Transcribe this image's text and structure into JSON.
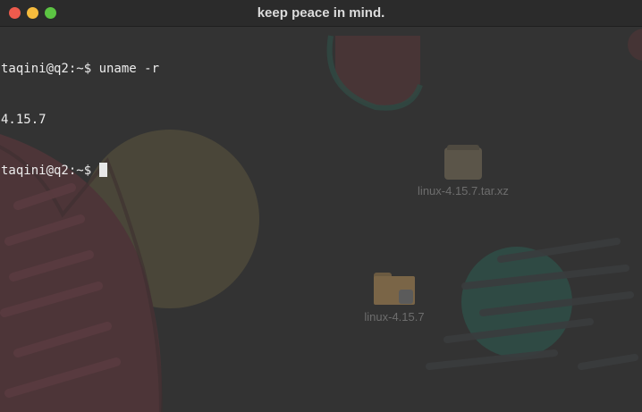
{
  "window": {
    "title": "keep peace in mind."
  },
  "terminal": {
    "lines": [
      "taqini@q2:~$ uname -r",
      "4.15.7",
      "taqini@q2:~$ "
    ]
  },
  "desktop": {
    "items": [
      {
        "label": "linux-4.15.7.tar.xz",
        "icon": "archive-icon"
      },
      {
        "label": "linux-4.15.7",
        "icon": "folder-icon"
      }
    ]
  },
  "colors": {
    "close": "#ee5b4d",
    "minimize": "#f5bb3d",
    "maximize": "#5cc443",
    "terminal_text": "#ececec",
    "background": "#333333"
  }
}
